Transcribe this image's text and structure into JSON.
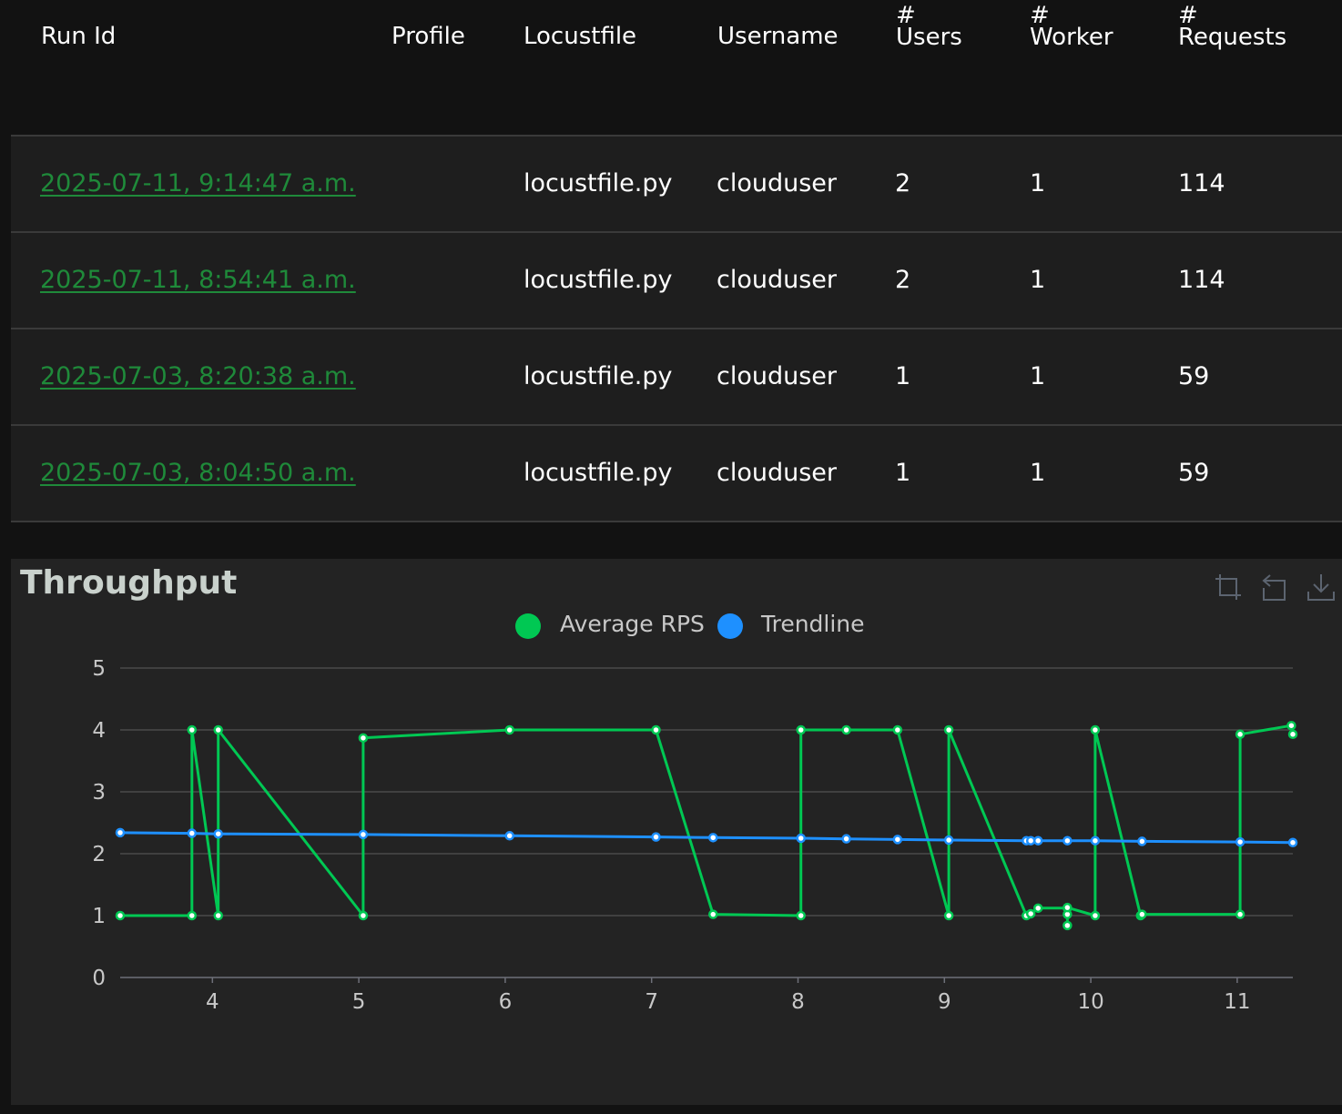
{
  "table": {
    "headers": {
      "run_id": "Run Id",
      "profile": "Profile",
      "locustfile": "Locustfile",
      "username": "Username",
      "users_hash": "#",
      "users": "Users",
      "worker_hash": "#",
      "worker": "Worker",
      "requests_hash": "#",
      "requests": "Requests"
    },
    "rows": [
      {
        "run_id": "2025-07-11, 9:14:47 a.m.",
        "profile": "",
        "locustfile": "locustfile.py",
        "username": "clouduser",
        "users": "2",
        "worker": "1",
        "requests": "114"
      },
      {
        "run_id": "2025-07-11, 8:54:41 a.m.",
        "profile": "",
        "locustfile": "locustfile.py",
        "username": "clouduser",
        "users": "2",
        "worker": "1",
        "requests": "114"
      },
      {
        "run_id": "2025-07-03, 8:20:38 a.m.",
        "profile": "",
        "locustfile": "locustfile.py",
        "username": "clouduser",
        "users": "1",
        "worker": "1",
        "requests": "59"
      },
      {
        "run_id": "2025-07-03, 8:04:50 a.m.",
        "profile": "",
        "locustfile": "locustfile.py",
        "username": "clouduser",
        "users": "1",
        "worker": "1",
        "requests": "59"
      }
    ]
  },
  "chart": {
    "toolbox_icons": [
      "zoom-icon",
      "zoom-reset-icon",
      "download-icon"
    ]
  },
  "colors": {
    "average_rps": "#00c853",
    "trendline": "#1e90ff",
    "link": "#1f8a3a",
    "grid": "#4a4a4a"
  },
  "chart_data": {
    "type": "line",
    "title": "Throughput",
    "xlabel": "",
    "ylabel": "",
    "xlim": [
      3.37,
      11.38
    ],
    "ylim": [
      0,
      5
    ],
    "x_ticks": [
      4,
      5,
      6,
      7,
      8,
      9,
      10,
      11
    ],
    "y_ticks": [
      0,
      1,
      2,
      3,
      4,
      5
    ],
    "grid": true,
    "legend_position": "top-center",
    "series": [
      {
        "name": "Average RPS",
        "points": [
          [
            3.37,
            1.0
          ],
          [
            3.86,
            1.0
          ],
          [
            3.86,
            4.0
          ],
          [
            4.04,
            1.0
          ],
          [
            4.04,
            4.0
          ],
          [
            5.03,
            1.0
          ],
          [
            5.03,
            3.87
          ],
          [
            6.03,
            4.0
          ],
          [
            7.03,
            4.0
          ],
          [
            7.42,
            1.02
          ],
          [
            8.02,
            1.0
          ],
          [
            8.02,
            4.0
          ],
          [
            8.33,
            4.0
          ],
          [
            8.68,
            4.0
          ],
          [
            9.03,
            1.0
          ],
          [
            9.03,
            4.0
          ],
          [
            9.56,
            1.0
          ],
          [
            9.59,
            1.03
          ],
          [
            9.64,
            1.12
          ],
          [
            9.84,
            1.12
          ],
          [
            9.84,
            1.02
          ],
          [
            9.84,
            0.84
          ],
          [
            9.84,
            1.13
          ],
          [
            10.03,
            1.0
          ],
          [
            10.03,
            4.0
          ],
          [
            10.34,
            1.0
          ],
          [
            10.35,
            1.02
          ],
          [
            11.02,
            1.02
          ],
          [
            11.02,
            3.93
          ],
          [
            11.37,
            4.07
          ],
          [
            11.38,
            3.93
          ]
        ]
      },
      {
        "name": "Trendline",
        "points": [
          [
            3.37,
            2.34
          ],
          [
            3.86,
            2.33
          ],
          [
            4.04,
            2.32
          ],
          [
            5.03,
            2.31
          ],
          [
            6.03,
            2.29
          ],
          [
            7.03,
            2.27
          ],
          [
            7.42,
            2.26
          ],
          [
            8.02,
            2.25
          ],
          [
            8.33,
            2.24
          ],
          [
            8.68,
            2.23
          ],
          [
            9.03,
            2.22
          ],
          [
            9.56,
            2.21
          ],
          [
            9.59,
            2.21
          ],
          [
            9.64,
            2.21
          ],
          [
            9.84,
            2.21
          ],
          [
            10.03,
            2.21
          ],
          [
            10.35,
            2.2
          ],
          [
            11.02,
            2.19
          ],
          [
            11.38,
            2.18
          ]
        ]
      }
    ]
  }
}
